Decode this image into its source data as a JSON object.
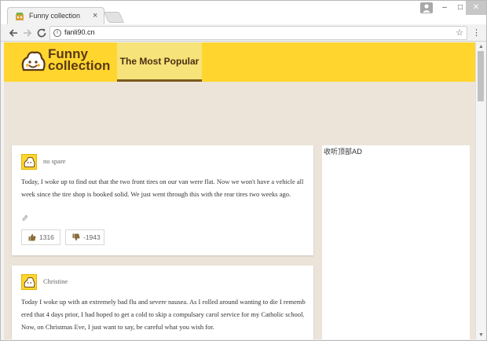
{
  "browser": {
    "tab_title": "Funny collection",
    "tab_close": "×",
    "url": "fanli90.cn",
    "controls": {
      "minimize": "–",
      "maximize": "□",
      "close": "✕"
    }
  },
  "site": {
    "logo_line1": "Funny",
    "logo_line2": "collection",
    "nav": [
      {
        "label": "The Most Popular"
      }
    ],
    "brand_color": "#ffd52e",
    "page_background": "#ece4d8"
  },
  "posts": [
    {
      "author": "no spare",
      "text": "Today, I woke up to find out that the two front tires on our van were flat. Now we won't have a vehicle all week since the tire shop is booked solid. We just went through this with the rear tires two weeks ago.",
      "upvotes": "1316",
      "downvotes": "-1943"
    },
    {
      "author": "Christine",
      "text": "Today I woke up with an extremely bad flu and severe nausea. As I rolled around wanting to die I remembered that 4 days prior, I had hoped to get a cold to skip a compulsary carol service for my Catholic school. Now, on Christmas Eve, I just want to say, be careful what you wish for."
    }
  ],
  "sidebar": {
    "label": "收听顶部AD"
  }
}
